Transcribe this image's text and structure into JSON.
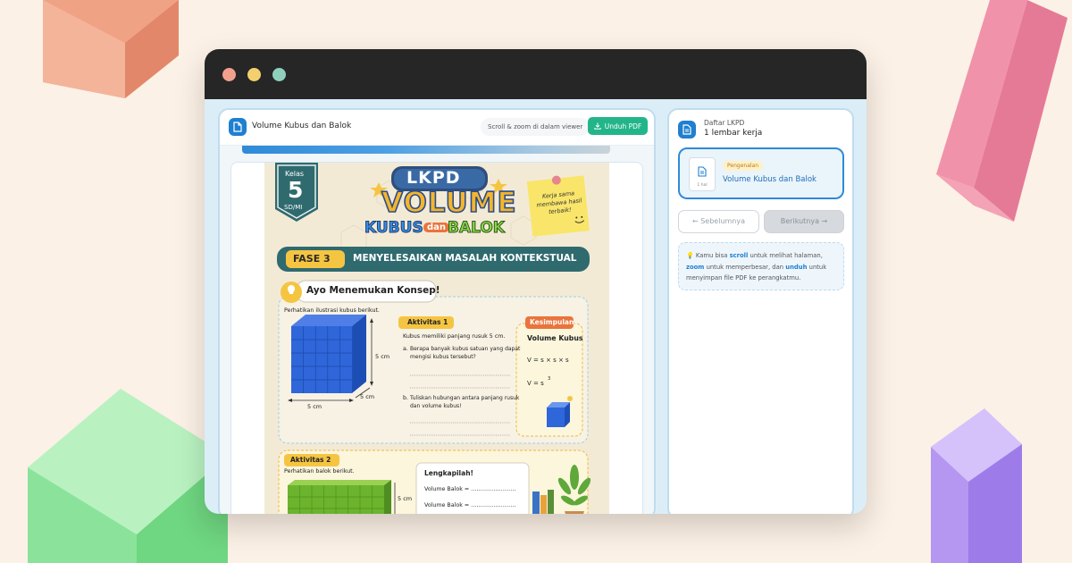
{
  "window": {
    "title_dots": [
      "#f2a08e",
      "#f4cf6e",
      "#8fd0bd"
    ]
  },
  "viewer": {
    "doc_title": "Volume Kubus dan Balok",
    "scroll_hint": "Scroll & zoom di dalam viewer",
    "download_label": "Unduh PDF"
  },
  "worksheet": {
    "grade_label": "Kelas",
    "grade_number": "5",
    "grade_level": "SD/MI",
    "banner_top": "LKPD",
    "banner_main": "VOLUME",
    "banner_sub_1": "KUBUS",
    "banner_sub_2": "dan",
    "banner_sub_3": "BALOK",
    "sticky_note": "Kerja sama membawa hasil terbaik!",
    "phase_label": "FASE 3",
    "phase_title": "MENYELESAIKAN MASALAH KONTEKSTUAL",
    "concept_heading": "Ayo Menemukan Konsep!",
    "cube_intro": "Perhatikan ilustrasi kubus berikut.",
    "cube_dim_side": "5 cm",
    "cube_dim_depth": "5 cm",
    "cube_dim_bottom": "5 cm",
    "activity1_label": "Aktivitas 1",
    "activity1_intro": "Kubus memiliki panjang rusuk 5 cm.",
    "activity1_q_a_marker": "a.",
    "activity1_q_a_line1": "Berapa banyak kubus satuan yang dapat",
    "activity1_q_a_line2": "mengisi kubus tersebut?",
    "activity1_q_b_marker": "b.",
    "activity1_q_b_line1": "Tuliskan hubungan antara panjang rusuk",
    "activity1_q_b_line2": "dan volume kubus!",
    "conclusion_label": "Kesimpulan",
    "conclusion_title": "Volume Kubus",
    "formula_1": "V = s × s × s",
    "formula_2": "V = s",
    "formula_2_exp": "3",
    "activity2_label": "Aktivitas 2",
    "activity2_intro": "Perhatikan balok berikut.",
    "beam_dim": "5 cm",
    "complete_title": "Lengkapilah!",
    "beam_volume_1": "Volume Balok = ……………………",
    "beam_volume_2": "Volume Balok = ……………………"
  },
  "sidebar": {
    "list_label": "Daftar LKPD",
    "sheet_count": "1 lembar kerja",
    "sheet_tag": "Pengenalan",
    "sheet_title": "Volume Kubus dan Balok",
    "thumb_caption": "1 hal",
    "prev_label": "← Sebelumnya",
    "next_label": "Berikutnya →",
    "tip_emoji": "💡",
    "tip_1": "Kamu bisa",
    "tip_scroll": "scroll",
    "tip_2": "untuk melihat halaman,",
    "tip_zoom": "zoom",
    "tip_3": "untuk memperbesar, dan",
    "tip_unduh": "unduh",
    "tip_4": "untuk menyimpan file PDF ke perangkatmu."
  }
}
